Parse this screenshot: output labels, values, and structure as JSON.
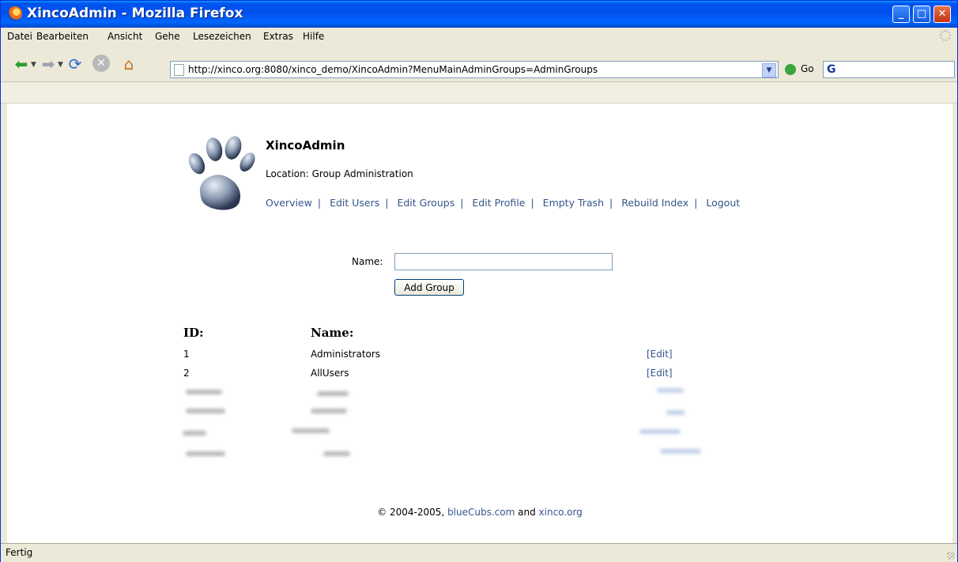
{
  "window": {
    "title": "XincoAdmin - Mozilla Firefox"
  },
  "menubar": {
    "items": [
      "Datei",
      "Bearbeiten",
      "Ansicht",
      "Gehe",
      "Lesezeichen",
      "Extras",
      "Hilfe"
    ]
  },
  "navbar": {
    "url": "http://xinco.org:8080/xinco_demo/XincoAdmin?MenuMainAdminGroups=AdminGroups",
    "go_label": "Go",
    "search_value": ""
  },
  "page": {
    "app_title": "XincoAdmin",
    "location": "Location: Group Administration",
    "nav_links": [
      "Overview",
      "Edit Users",
      "Edit Groups",
      "Edit Profile",
      "Empty Trash",
      "Rebuild Index",
      "Logout"
    ],
    "form": {
      "name_label": "Name:",
      "name_value": "",
      "add_button": "Add Group"
    },
    "table": {
      "headers": {
        "id": "ID:",
        "name": "Name:"
      },
      "rows": [
        {
          "id": "1",
          "name": "Administrators",
          "action": "[Edit]"
        },
        {
          "id": "2",
          "name": "AllUsers",
          "action": "[Edit]"
        }
      ]
    },
    "footer": {
      "prefix": "© 2004-2005, ",
      "link1": "blueCubs.com",
      "middle": " and ",
      "link2": "xinco.org"
    }
  },
  "statusbar": {
    "text": "Fertig"
  }
}
